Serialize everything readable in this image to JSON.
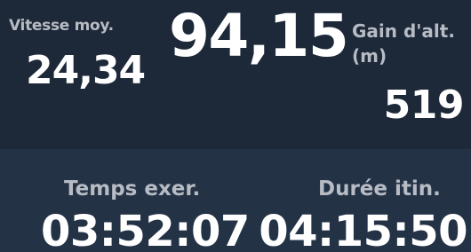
{
  "colors": {
    "top_panel_background": "#1d2839",
    "bottom_panel_background": "#243246",
    "label_text": "#b7bcc4",
    "value_text": "#ffffff"
  },
  "fields": {
    "avg_speed": {
      "label": "Vitesse moy.",
      "value": "24,34"
    },
    "current_speed": {
      "value": "94,15"
    },
    "elevation_gain": {
      "label": "Gain d'alt. (m)",
      "value": "519"
    },
    "workout_time": {
      "label": "Temps exer.",
      "value": "03:52:07"
    },
    "route_duration": {
      "label": "Durée itin.",
      "value": "04:15:50"
    }
  }
}
